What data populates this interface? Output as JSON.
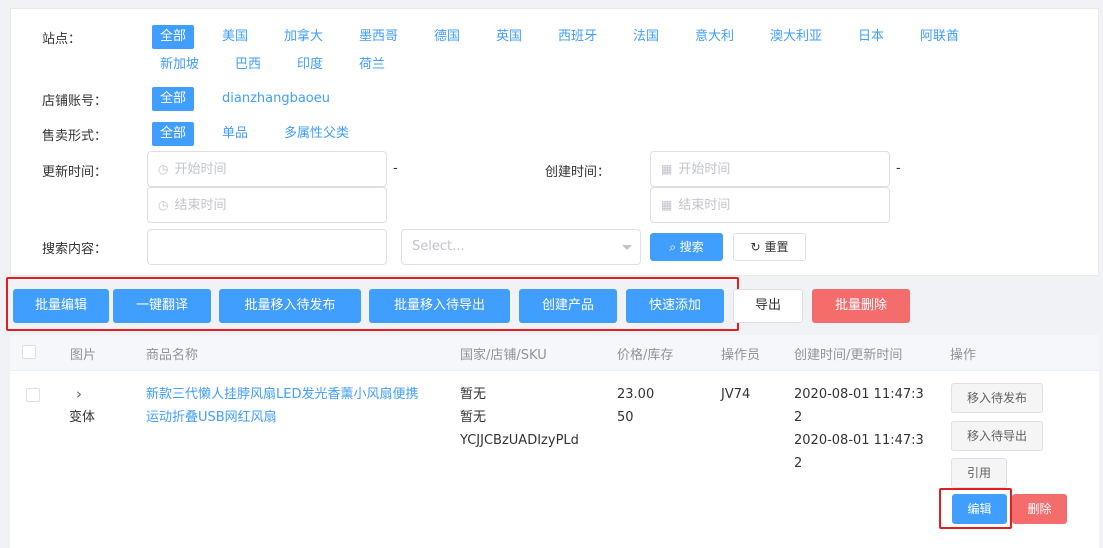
{
  "filters": {
    "site_label": "站点：",
    "sites": [
      "全部",
      "美国",
      "加拿大",
      "墨西哥",
      "德国",
      "英国",
      "西班牙",
      "法国",
      "意大利",
      "澳大利亚",
      "日本",
      "阿联酋",
      "新加坡",
      "巴西",
      "印度",
      "荷兰"
    ],
    "shop_label": "店铺账号：",
    "shops": [
      "全部",
      "dianzhangbaoeu"
    ],
    "sale_label": "售卖形式：",
    "sale_types": [
      "全部",
      "单品",
      "多属性父类"
    ],
    "update_label": "更新时间：",
    "create_label": "创建时间：",
    "start_placeholder": "开始时间",
    "end_placeholder": "结束时间",
    "dash": "-",
    "search_label": "搜索内容：",
    "select_placeholder": "Select...",
    "search_btn": "搜索",
    "reset_btn": "重置"
  },
  "actions": {
    "batch_edit": "批量编辑",
    "translate": "一键翻译",
    "move_publish": "批量移入待发布",
    "move_export": "批量移入待导出",
    "create_product": "创建产品",
    "quick_add": "快速添加",
    "export": "导出",
    "batch_delete": "批量删除"
  },
  "table": {
    "headers": [
      "图片",
      "商品名称",
      "国家/店铺/SKU",
      "价格/库存",
      "操作员",
      "创建时间/更新时间",
      "操作"
    ],
    "row": {
      "expand": "›",
      "variant": "变体",
      "name_line1": "新款三代懒人挂脖风扇LED发光香薰小风扇便携",
      "name_line2": "运动折叠USB网红风扇",
      "country": "暂无",
      "shop": "暂无",
      "sku": "YCJJCBzUADIzyPLd",
      "price": "23.00",
      "stock": "50",
      "operator": "JV74",
      "created_a": "2020-08-01 11:47:3",
      "created_b": "2",
      "updated_a": "2020-08-01 11:47:3",
      "updated_b": "2",
      "btn_move_publish": "移入待发布",
      "btn_move_export": "移入待导出",
      "btn_cite": "引用",
      "btn_edit": "编辑",
      "btn_delete": "删除"
    }
  }
}
